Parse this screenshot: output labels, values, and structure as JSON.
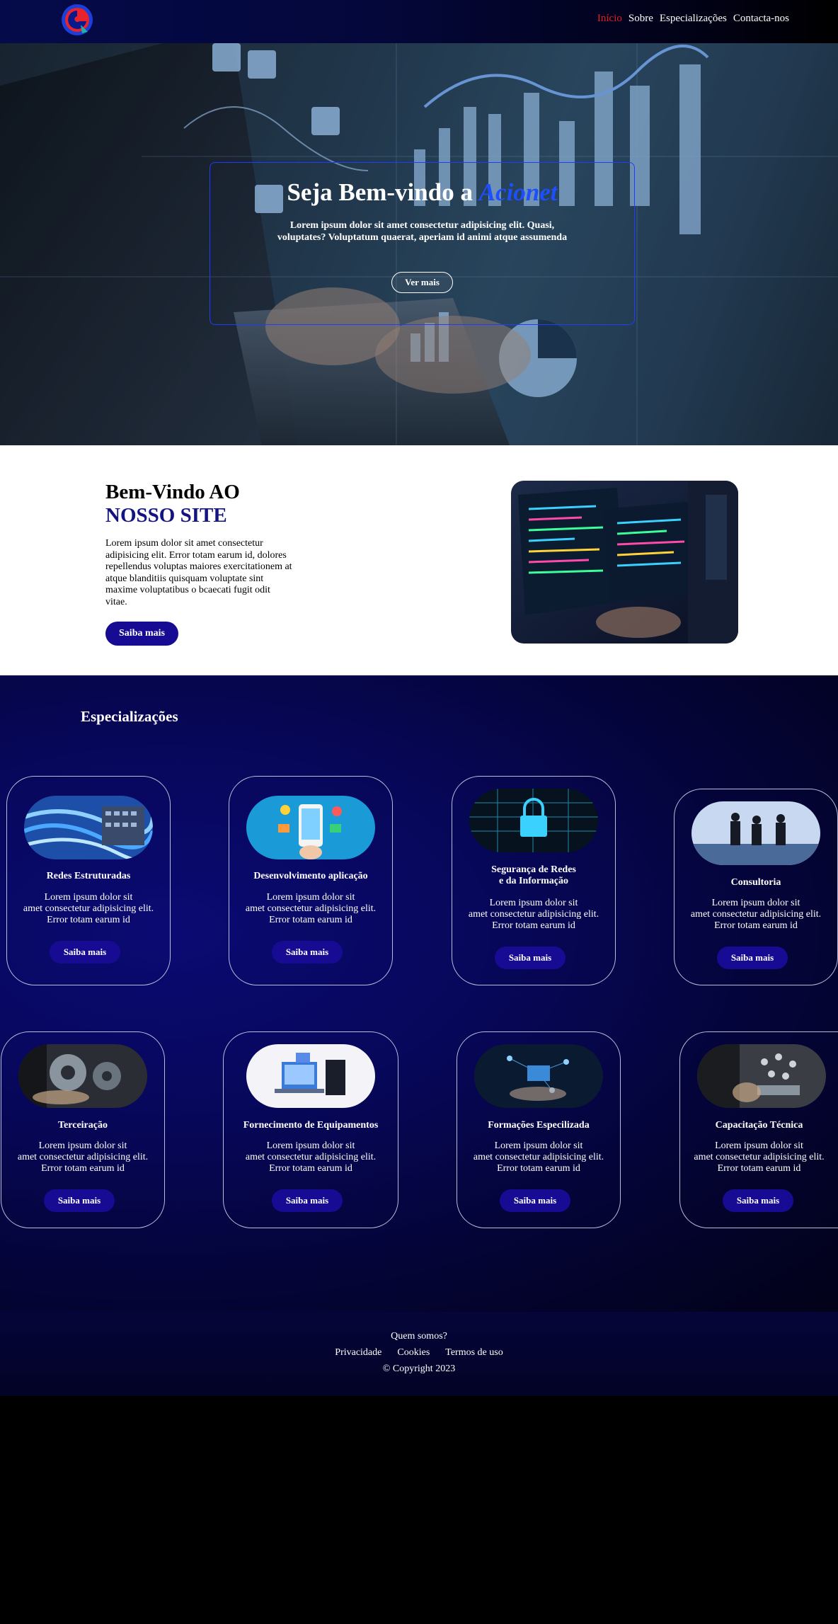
{
  "nav": {
    "logo_icon": "brand-logo-icon",
    "items": [
      "Início",
      "Sobre",
      "Especializações",
      "Contacta-nos"
    ],
    "active_color": "#e41f1f"
  },
  "hero": {
    "title_prefix": "Seja Bem-vindo a ",
    "title_brand": "Acionet",
    "text": "Lorem ipsum dolor sit amet consectetur adipisicing elit. Quasi, voluptates? Voluptatum quaerat, aperiam id animi atque assumenda",
    "button": "Ver mais",
    "border_color": "#1f3cff",
    "brand_color": "#1e4fff"
  },
  "welcome": {
    "title_line1": "Bem-Vindo AO",
    "title_line2": "NOSSO SITE",
    "text": "Lorem ipsum dolor sit amet consectetur adipisicing elit. Error totam earum id, dolores repellendus voluptas maiores exercitationem at atque blanditiis quisquam voluptate sint maxime voluptatibus o bcaecati fugit odit vitae.",
    "button": "Saiba mais",
    "accent_color": "#141480"
  },
  "specializations": {
    "title": "Especializações",
    "cards": [
      {
        "title": "Redes Estruturadas",
        "text1": "Lorem ipsum dolor sit",
        "text2": "amet consectetur adipisicing elit.",
        "text3": "Error totam earum id",
        "button": "Saiba mais",
        "image": "network-cables-image"
      },
      {
        "title": "Desenvolvimento aplicação",
        "text1": "Lorem ipsum dolor sit",
        "text2": "amet consectetur adipisicing elit.",
        "text3": "Error totam earum id",
        "button": "Saiba mais",
        "image": "mobile-app-image"
      },
      {
        "title": "Segurança de Redes",
        "title2": "e da Informação",
        "text1": "Lorem ipsum dolor sit",
        "text2": "amet consectetur adipisicing elit.",
        "text3": "Error totam earum id",
        "button": "Saiba mais",
        "image": "security-lock-image"
      },
      {
        "title": "Consultoria",
        "text1": "Lorem ipsum dolor sit",
        "text2": "amet consectetur adipisicing elit.",
        "text3": "Error totam earum id",
        "button": "Saiba mais",
        "image": "business-meeting-image"
      },
      {
        "title": "Terceiração",
        "text1": "Lorem ipsum dolor sit",
        "text2": "amet consectetur adipisicing elit.",
        "text3": "Error totam earum id",
        "button": "Saiba mais",
        "image": "gears-hand-image"
      },
      {
        "title": "Fornecimento de Equipamentos",
        "text1": "Lorem ipsum dolor sit",
        "text2": "amet consectetur adipisicing elit.",
        "text3": "Error totam earum id",
        "button": "Saiba mais",
        "image": "computer-equipment-image"
      },
      {
        "title": "Formações Especilizada",
        "text1": "Lorem ipsum dolor sit",
        "text2": "amet consectetur adipisicing elit.",
        "text3": "Error totam earum id",
        "button": "Saiba mais",
        "image": "digital-training-image"
      },
      {
        "title": "Capacitação Técnica",
        "text1": "Lorem ipsum dolor sit",
        "text2": "amet consectetur adipisicing elit.",
        "text3": "Error totam earum id",
        "button": "Saiba mais",
        "image": "tablet-network-image"
      }
    ],
    "button_color": "#170b94"
  },
  "footer": {
    "who": "Quem somos?",
    "links": [
      "Privacidade",
      "Cookies",
      "Termos de uso"
    ],
    "copyright": "© Copyright 2023"
  }
}
